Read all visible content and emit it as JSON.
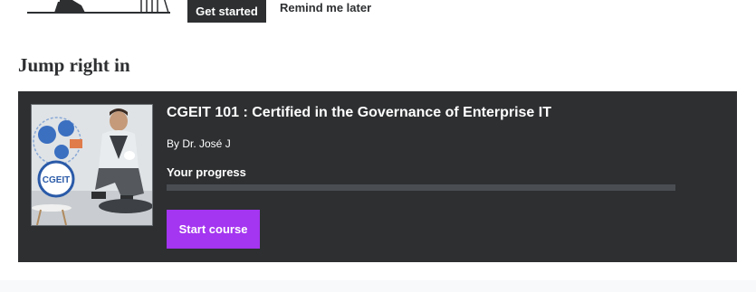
{
  "banner": {
    "get_started_label": "Get started",
    "remind_label": "Remind me later"
  },
  "section": {
    "title": "Jump right in"
  },
  "course": {
    "title": "CGEIT 101 : Certified in the Governance of Enterprise IT",
    "author": "By Dr. José J",
    "progress_label": "Your progress",
    "progress_fraction": 0,
    "start_label": "Start course",
    "thumbnail_logo_text": "CGEIT"
  },
  "colors": {
    "card_background": "#2d2f31",
    "accent_purple": "#a435f0",
    "progress_track": "#4a4e52"
  }
}
